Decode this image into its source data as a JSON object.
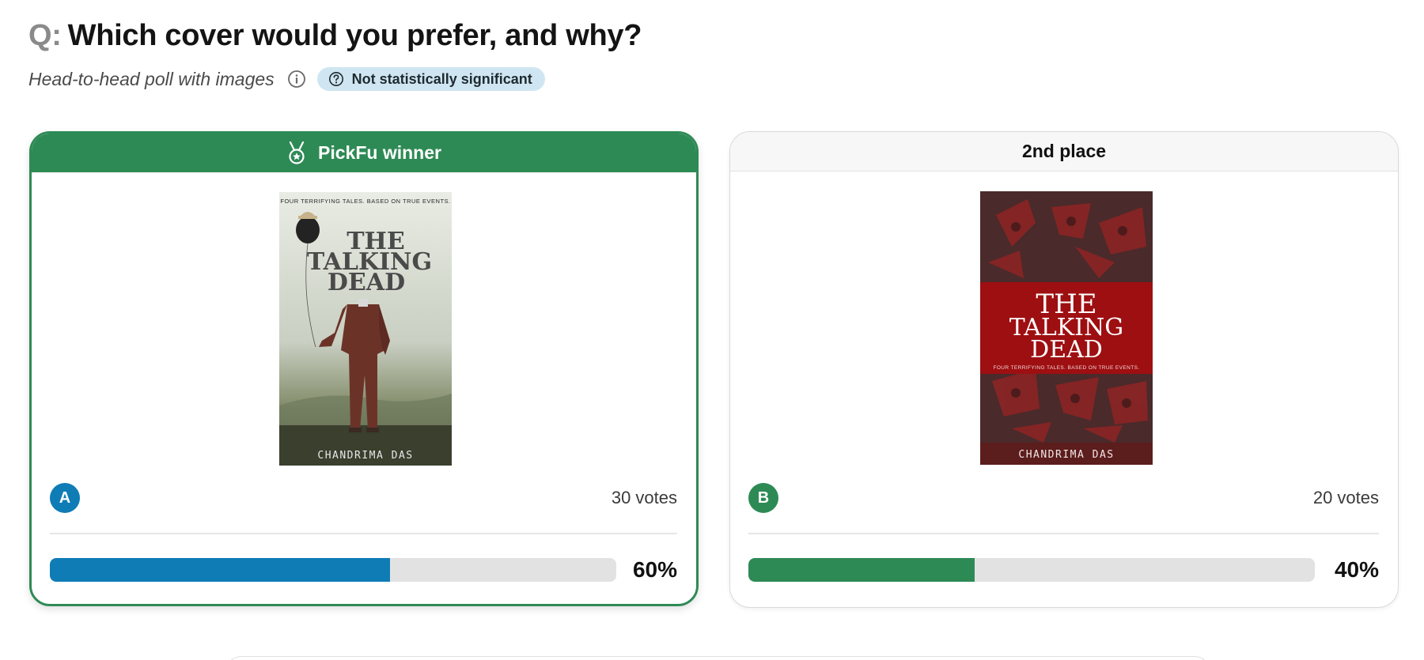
{
  "question": {
    "prefix": "Q:",
    "text": "Which cover would you prefer, and why?"
  },
  "poll": {
    "type_label": "Head-to-head poll with images",
    "info_icon": "info-circle-icon",
    "significance_badge": {
      "icon": "question-circle-icon",
      "label": "Not statistically significant",
      "color": "#cfe6f2"
    }
  },
  "options": [
    {
      "header_label": "PickFu winner",
      "header_icon": "medal-icon",
      "letter": "A",
      "votes_label": "30 votes",
      "percent_label": "60%",
      "share": 0.6,
      "bar_color": "#0f7cb6",
      "header_color": "#2e8a55",
      "cover": {
        "tagline": "FOUR TERRIFYING TALES. BASED ON TRUE EVENTS.",
        "title_lines": [
          "THE",
          "TALKING",
          "DEAD"
        ],
        "author": "CHANDRIMA DAS"
      }
    },
    {
      "header_label": "2nd place",
      "letter": "B",
      "votes_label": "20 votes",
      "percent_label": "40%",
      "share": 0.4,
      "bar_color": "#2e8a55",
      "cover": {
        "tagline": "FOUR TERRIFYING TALES. BASED ON TRUE EVENTS.",
        "title_lines": [
          "THE",
          "TALKING",
          "DEAD"
        ],
        "author": "CHANDRIMA DAS"
      }
    }
  ]
}
